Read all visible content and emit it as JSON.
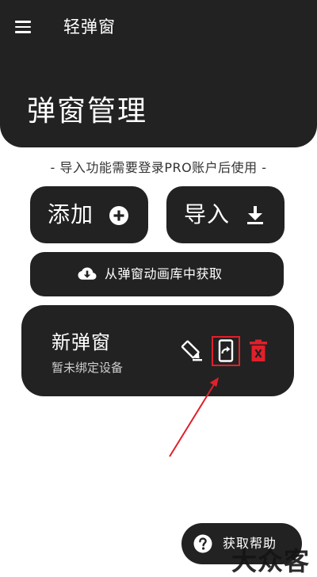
{
  "app": {
    "title": "轻弹窗"
  },
  "header": {
    "menu_icon": "menu-icon",
    "page_title": "弹窗管理"
  },
  "notice": {
    "text": "- 导入功能需要登录PRO账户后使用 -"
  },
  "actions": {
    "add_label": "添加",
    "add_icon": "plus-circle-icon",
    "import_label": "导入",
    "import_icon": "download-icon",
    "library_label": "从弹窗动画库中获取",
    "library_icon": "cloud-download-icon"
  },
  "popup_list": [
    {
      "name": "新弹窗",
      "status": "暂未绑定设备",
      "edit_icon": "pencil-icon",
      "bind_icon": "phone-share-icon",
      "delete_icon": "trash-icon"
    }
  ],
  "help": {
    "label": "获取帮助",
    "icon": "help-circle-icon"
  },
  "watermark": {
    "text": "大众客"
  },
  "colors": {
    "dark": "#222222",
    "background": "#ffffff",
    "delete": "#e0202a",
    "annotation": "#e0202a"
  }
}
